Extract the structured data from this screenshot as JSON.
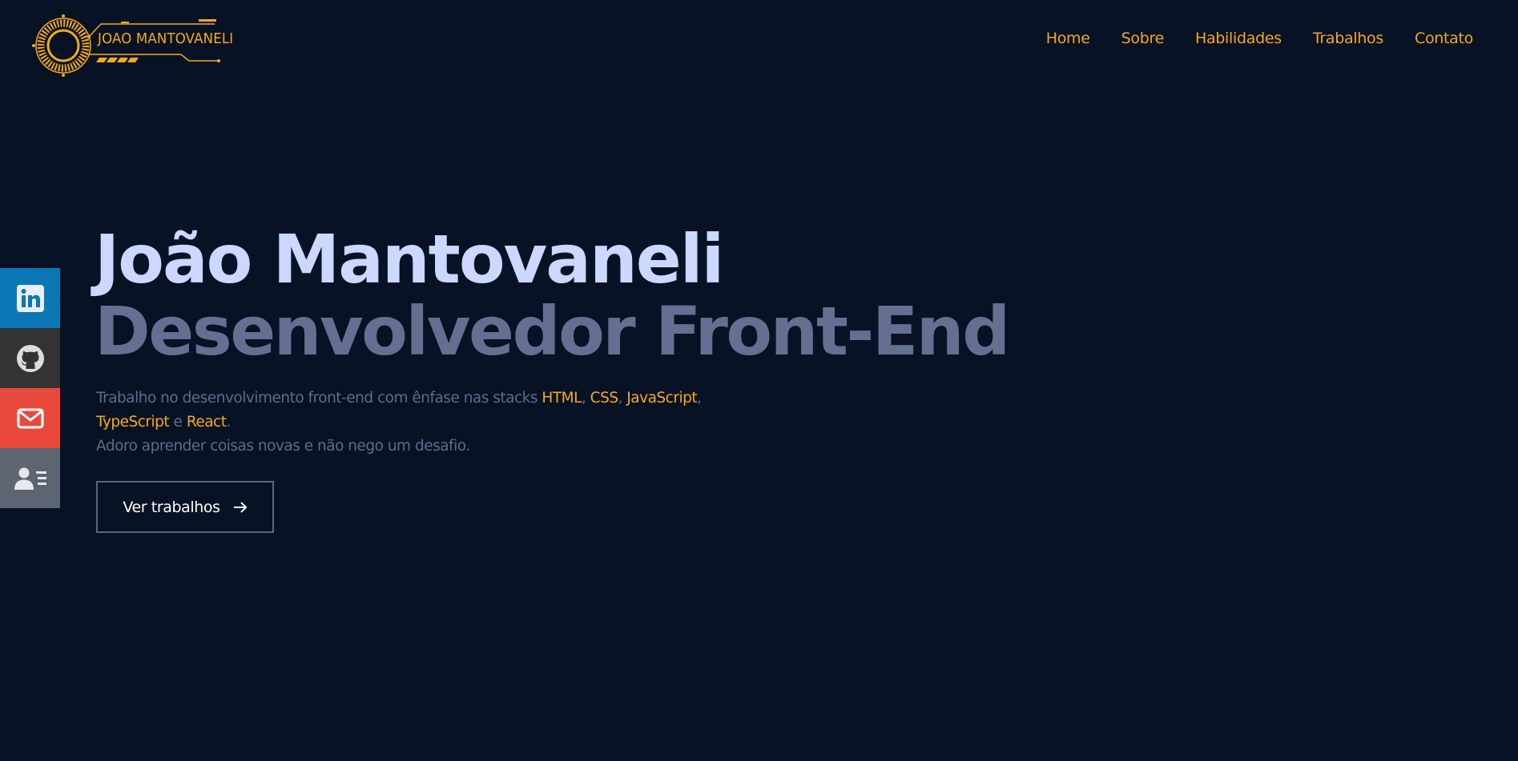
{
  "header": {
    "logo_text": "JOAO MANTOVANELI",
    "nav": [
      "Home",
      "Sobre",
      "Habilidades",
      "Trabalhos",
      "Contato"
    ]
  },
  "social": {
    "items": [
      {
        "name": "linkedin",
        "icon": "linkedin-icon",
        "color": "#0b77b5"
      },
      {
        "name": "github",
        "icon": "github-icon",
        "color": "#333333"
      },
      {
        "name": "email",
        "icon": "mail-icon",
        "color": "#e9493c"
      },
      {
        "name": "resume",
        "icon": "contact-card-icon",
        "color": "#5c6570"
      }
    ]
  },
  "hero": {
    "name": "João Mantovaneli",
    "role": "Desenvolvedor Front-End",
    "desc": {
      "prefix": "Trabalho no desenvolvimento front-end com ênfase nas stacks ",
      "html": "HTML",
      "sep1": ", ",
      "css": "CSS",
      "sep2": ", ",
      "js": "JavaScript",
      "sep3": ",",
      "ts": "TypeScript",
      "and": " e ",
      "react": "React",
      "end": ".",
      "line2": "Adoro aprender coisas novas e não nego um desafio."
    },
    "cta_label": "Ver trabalhos"
  },
  "colors": {
    "background": "#081225",
    "accent": "#f5ab18",
    "title": "#ccd8ff",
    "subtitle": "#646f92",
    "body_text": "#5f6b8c"
  }
}
